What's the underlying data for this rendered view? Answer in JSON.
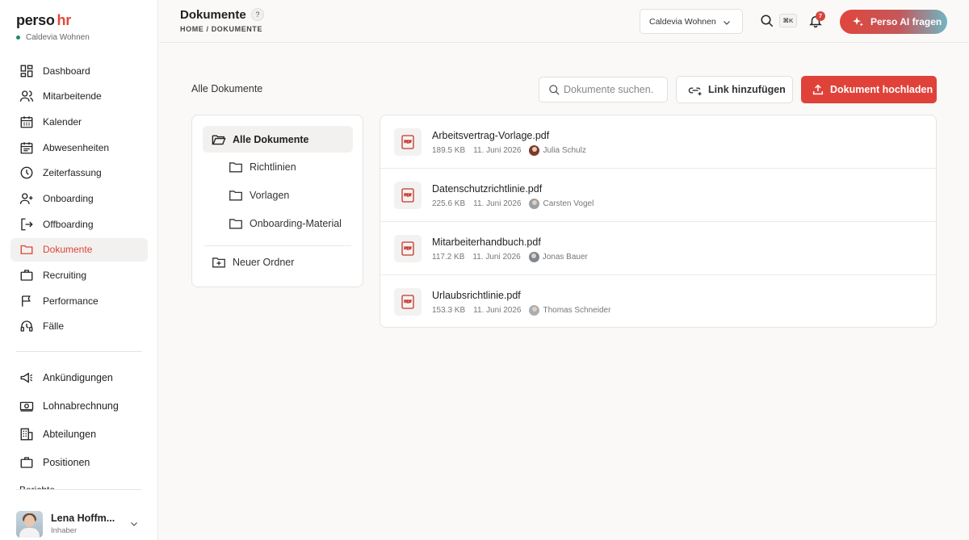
{
  "brand": {
    "name": "perso",
    "suffix": "hr",
    "company": "Caldevia Wohnen"
  },
  "sidebar": {
    "items": [
      {
        "label": "Dashboard",
        "icon": "dashboard-icon"
      },
      {
        "label": "Mitarbeitende",
        "icon": "users-icon"
      },
      {
        "label": "Kalender",
        "icon": "calendar-icon"
      },
      {
        "label": "Abwesenheiten",
        "icon": "absence-icon"
      },
      {
        "label": "Zeiterfassung",
        "icon": "clock-icon"
      },
      {
        "label": "Onboarding",
        "icon": "user-plus-icon"
      },
      {
        "label": "Offboarding",
        "icon": "logout-icon"
      },
      {
        "label": "Dokumente",
        "icon": "folder-icon",
        "active": true
      },
      {
        "label": "Recruiting",
        "icon": "briefcase-icon"
      },
      {
        "label": "Performance",
        "icon": "flag-icon"
      },
      {
        "label": "Fälle",
        "icon": "headset-icon"
      }
    ],
    "secondary": [
      {
        "label": "Ankündigungen",
        "icon": "megaphone-icon"
      },
      {
        "label": "Lohnabrechnung",
        "icon": "payroll-icon"
      },
      {
        "label": "Abteilungen",
        "icon": "building-icon"
      },
      {
        "label": "Positionen",
        "icon": "briefcase-icon"
      }
    ],
    "cut_item": "Berichte"
  },
  "user": {
    "name": "Lena Hoffm...",
    "role": "Inhaber"
  },
  "header": {
    "title": "Dokumente",
    "help": "?",
    "breadcrumb": "HOME / DOKUMENTE",
    "tenant": "Caldevia Wohnen",
    "shortcut": "⌘K",
    "notifications": "7",
    "ai_button": "Perso AI fragen"
  },
  "main": {
    "section_title": "Alle Dokumente",
    "search_placeholder": "Dokumente suchen.",
    "link_button": "Link hinzufügen",
    "upload_button": "Dokument hochladen"
  },
  "folders": {
    "root": "Alle Dokumente",
    "children": [
      "Richtlinien",
      "Vorlagen",
      "Onboarding-Material"
    ],
    "new_folder": "Neuer Ordner"
  },
  "files": [
    {
      "name": "Arbeitsvertrag-Vorlage.pdf",
      "size": "189.5 KB",
      "date": "11. Juni 2026",
      "owner": "Julia Schulz"
    },
    {
      "name": "Datenschutzrichtlinie.pdf",
      "size": "225.6 KB",
      "date": "11. Juni 2026",
      "owner": "Carsten Vogel"
    },
    {
      "name": "Mitarbeiterhandbuch.pdf",
      "size": "117.2 KB",
      "date": "11. Juni 2026",
      "owner": "Jonas Bauer"
    },
    {
      "name": "Urlaubsrichtlinie.pdf",
      "size": "153.3 KB",
      "date": "11. Juni 2026",
      "owner": "Thomas Schneider"
    }
  ],
  "colors": {
    "accent": "#e0423a",
    "brand_suffix": "#e3483a",
    "status_dot": "#1d8a6b"
  }
}
